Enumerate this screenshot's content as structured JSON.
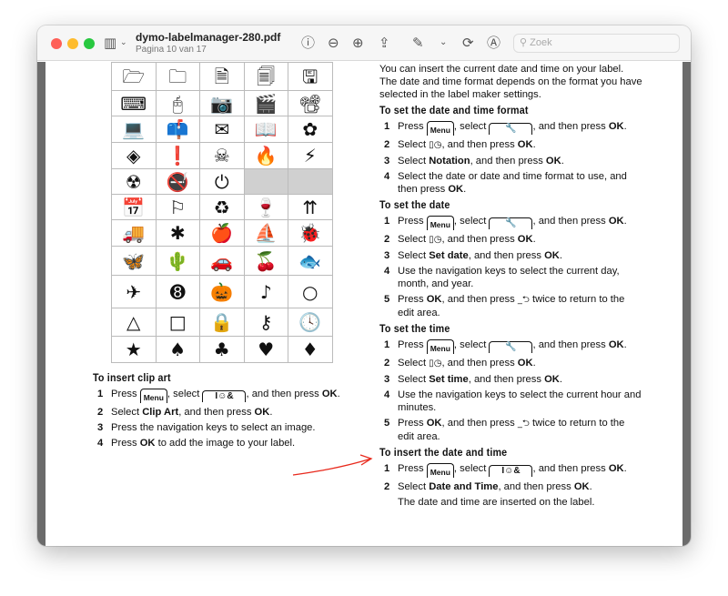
{
  "window": {
    "title": "dymo-labelmanager-280.pdf",
    "subtitle": "Pagina 10 van 17",
    "search_placeholder": "Zoek",
    "traffic_colors": {
      "close": "#fe5f57",
      "minimize": "#febc2e",
      "zoom": "#28c840"
    },
    "toolbar_icons": [
      "sidebar-icon",
      "chevron-down-icon",
      "info-icon",
      "zoom-out-icon",
      "zoom-in-icon",
      "share-icon",
      "markup-pen-icon",
      "chevron-down-icon",
      "rotate-icon",
      "annotate-icon",
      "search-icon"
    ]
  },
  "clipart_grid": [
    [
      "open-folder",
      "folder",
      "document",
      "documents",
      "floppy-disk"
    ],
    [
      "keyboard",
      "mouse",
      "camera",
      "clapperboard",
      "film-projector"
    ],
    [
      "laptop",
      "mailbox",
      "envelope",
      "book",
      "flower"
    ],
    [
      "hazard-corrosive",
      "hazard-exclamation",
      "hazard-toxic",
      "hazard-flammable",
      "warning-electric"
    ],
    [
      "warning-radiation",
      "no-smoking",
      "power",
      "empty",
      "empty"
    ],
    [
      "calendar",
      "flag",
      "recycle",
      "fragile-glass",
      "this-side-up"
    ],
    [
      "truck",
      "asterisk-flower",
      "apple",
      "sailboat",
      "bug"
    ],
    [
      "butterfly",
      "cactus",
      "car",
      "cherries",
      "fish"
    ],
    [
      "airplane",
      "eight-ball",
      "pumpkin",
      "music-note",
      "circle"
    ],
    [
      "triangle",
      "square",
      "padlock",
      "key",
      "clock"
    ],
    [
      "star",
      "spade",
      "club",
      "heart",
      "diamond"
    ]
  ],
  "left": {
    "heading": "To insert clip art",
    "steps": [
      {
        "n": "1",
        "parts": [
          [
            "t",
            "Press "
          ],
          [
            "menu",
            "Menu"
          ],
          [
            "t",
            ", select "
          ],
          [
            "key",
            "I☺&"
          ],
          [
            "t",
            ", and then press "
          ],
          [
            "b",
            "OK"
          ],
          [
            "t",
            "."
          ]
        ]
      },
      {
        "n": "2",
        "parts": [
          [
            "t",
            "Select "
          ],
          [
            "b",
            "Clip Art"
          ],
          [
            "t",
            ", and then press "
          ],
          [
            "b",
            "OK"
          ],
          [
            "t",
            "."
          ]
        ]
      },
      {
        "n": "3",
        "parts": [
          [
            "t",
            "Press the navigation keys to select an image."
          ]
        ]
      },
      {
        "n": "4",
        "parts": [
          [
            "t",
            "Press "
          ],
          [
            "b",
            "OK"
          ],
          [
            "t",
            " to add the image to your label."
          ]
        ]
      }
    ]
  },
  "right": {
    "intro": "You can insert the current date and time on your label. The date and time format depends on the format you have selected in the label maker settings.",
    "sections": [
      {
        "heading": "To set the date and time format",
        "steps": [
          {
            "n": "1",
            "parts": [
              [
                "t",
                "Press "
              ],
              [
                "menu",
                "Menu"
              ],
              [
                "t",
                ", select "
              ],
              [
                "key",
                "🔧"
              ],
              [
                "t",
                ", and then press "
              ],
              [
                "b",
                "OK"
              ],
              [
                "t",
                "."
              ]
            ]
          },
          {
            "n": "2",
            "parts": [
              [
                "t",
                "Select "
              ],
              [
                "sym",
                "▯◷"
              ],
              [
                "t",
                ", and then press "
              ],
              [
                "b",
                "OK"
              ],
              [
                "t",
                "."
              ]
            ]
          },
          {
            "n": "3",
            "parts": [
              [
                "t",
                "Select "
              ],
              [
                "b",
                "Notation"
              ],
              [
                "t",
                ", and then press "
              ],
              [
                "b",
                "OK"
              ],
              [
                "t",
                "."
              ]
            ]
          },
          {
            "n": "4",
            "parts": [
              [
                "t",
                "Select the date or date and time format to use, and then press "
              ],
              [
                "b",
                "OK"
              ],
              [
                "t",
                "."
              ]
            ]
          }
        ]
      },
      {
        "heading": "To set the date",
        "steps": [
          {
            "n": "1",
            "parts": [
              [
                "t",
                "Press "
              ],
              [
                "menu",
                "Menu"
              ],
              [
                "t",
                ", select "
              ],
              [
                "key",
                "🔧"
              ],
              [
                "t",
                ", and then press "
              ],
              [
                "b",
                "OK"
              ],
              [
                "t",
                "."
              ]
            ]
          },
          {
            "n": "2",
            "parts": [
              [
                "t",
                "Select "
              ],
              [
                "sym",
                "▯◷"
              ],
              [
                "t",
                ", and then press "
              ],
              [
                "b",
                "OK"
              ],
              [
                "t",
                "."
              ]
            ]
          },
          {
            "n": "3",
            "parts": [
              [
                "t",
                "Select "
              ],
              [
                "b",
                "Set date"
              ],
              [
                "t",
                ", and then press "
              ],
              [
                "b",
                "OK"
              ],
              [
                "t",
                "."
              ]
            ]
          },
          {
            "n": "4",
            "parts": [
              [
                "t",
                "Use the navigation keys to select the current day, month, and year."
              ]
            ]
          },
          {
            "n": "5",
            "parts": [
              [
                "t",
                "Press "
              ],
              [
                "b",
                "OK"
              ],
              [
                "t",
                ", and then press "
              ],
              [
                "sym",
                "_⮌"
              ],
              [
                "t",
                " twice to return to the edit area."
              ]
            ]
          }
        ]
      },
      {
        "heading": "To set the time",
        "steps": [
          {
            "n": "1",
            "parts": [
              [
                "t",
                "Press "
              ],
              [
                "menu",
                "Menu"
              ],
              [
                "t",
                ", select "
              ],
              [
                "key",
                "🔧"
              ],
              [
                "t",
                ", and then press "
              ],
              [
                "b",
                "OK"
              ],
              [
                "t",
                "."
              ]
            ]
          },
          {
            "n": "2",
            "parts": [
              [
                "t",
                "Select "
              ],
              [
                "sym",
                "▯◷"
              ],
              [
                "t",
                ", and then press "
              ],
              [
                "b",
                "OK"
              ],
              [
                "t",
                "."
              ]
            ]
          },
          {
            "n": "3",
            "parts": [
              [
                "t",
                "Select "
              ],
              [
                "b",
                "Set time"
              ],
              [
                "t",
                ", and then press "
              ],
              [
                "b",
                "OK"
              ],
              [
                "t",
                "."
              ]
            ]
          },
          {
            "n": "4",
            "parts": [
              [
                "t",
                "Use the navigation keys to select the current hour and minutes."
              ]
            ]
          },
          {
            "n": "5",
            "parts": [
              [
                "t",
                "Press "
              ],
              [
                "b",
                "OK"
              ],
              [
                "t",
                ", and then press "
              ],
              [
                "sym",
                "_⮌"
              ],
              [
                "t",
                " twice to return to the edit area."
              ]
            ]
          }
        ]
      },
      {
        "heading": "To insert the date and time",
        "steps": [
          {
            "n": "1",
            "parts": [
              [
                "t",
                "Press "
              ],
              [
                "menu",
                "Menu"
              ],
              [
                "t",
                ", select "
              ],
              [
                "key",
                "I☺&"
              ],
              [
                "t",
                ", and then press "
              ],
              [
                "b",
                "OK"
              ],
              [
                "t",
                "."
              ]
            ]
          },
          {
            "n": "2",
            "parts": [
              [
                "t",
                "Select "
              ],
              [
                "b",
                "Date and Time"
              ],
              [
                "t",
                ", and then press "
              ],
              [
                "b",
                "OK"
              ],
              [
                "t",
                "."
              ]
            ]
          }
        ],
        "note": "The date and time are inserted on the label."
      }
    ]
  },
  "annotation": {
    "arrow_color": "#e8291c"
  }
}
